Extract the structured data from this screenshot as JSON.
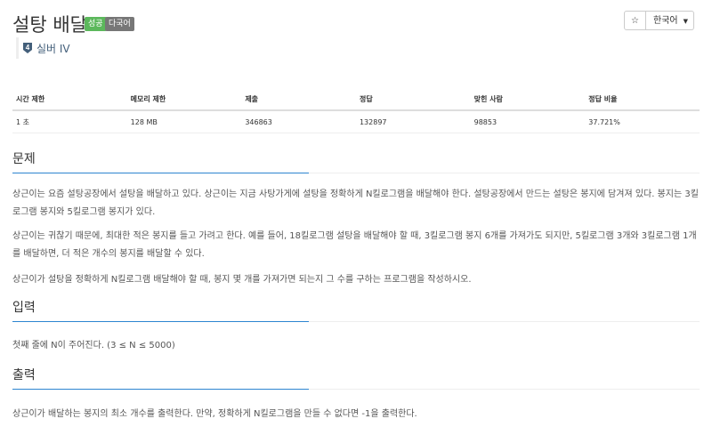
{
  "problem": {
    "title": "설탕 배달",
    "badges": {
      "success": "성공",
      "multilang": "다국어"
    },
    "tier": "실버 IV",
    "tier_number": "4"
  },
  "toolbar": {
    "star_icon": "star-icon",
    "language": "한국어"
  },
  "stats": {
    "headers": [
      "시간 제한",
      "메모리 제한",
      "제출",
      "정답",
      "맞힌 사람",
      "정답 비율"
    ],
    "values": [
      "1 초",
      "128 MB",
      "346863",
      "132897",
      "98853",
      "37.721%"
    ]
  },
  "sections": {
    "description": {
      "title": "문제",
      "paragraphs": [
        "상근이는 요즘 설탕공장에서 설탕을 배달하고 있다. 상근이는 지금 사탕가게에 설탕을 정확하게 N킬로그램을 배달해야 한다. 설탕공장에서 만드는 설탕은 봉지에 담겨져 있다. 봉지는 3킬로그램 봉지와 5킬로그램 봉지가 있다.",
        "상근이는 귀찮기 때문에, 최대한 적은 봉지를 들고 가려고 한다. 예를 들어, 18킬로그램 설탕을 배달해야 할 때, 3킬로그램 봉지 6개를 가져가도 되지만, 5킬로그램 3개와 3킬로그램 1개를 배달하면, 더 적은 개수의 봉지를 배달할 수 있다.",
        "상근이가 설탕을 정확하게 N킬로그램 배달해야 할 때, 봉지 몇 개를 가져가면 되는지 그 수를 구하는 프로그램을 작성하시오."
      ]
    },
    "input": {
      "title": "입력",
      "paragraphs": [
        "첫째 줄에 N이 주어진다. (3 ≤ N ≤ 5000)"
      ]
    },
    "output": {
      "title": "출력",
      "paragraphs": [
        "상근이가 배달하는 봉지의 최소 개수를 출력한다. 만약, 정확하게 N킬로그램을 만들 수 없다면 -1을 출력한다."
      ]
    }
  },
  "colors": {
    "accent_underline": "#2d85d0",
    "badge_success": "#5cb85c",
    "badge_multilang": "#777777",
    "tier_silver": "#435f7a"
  }
}
